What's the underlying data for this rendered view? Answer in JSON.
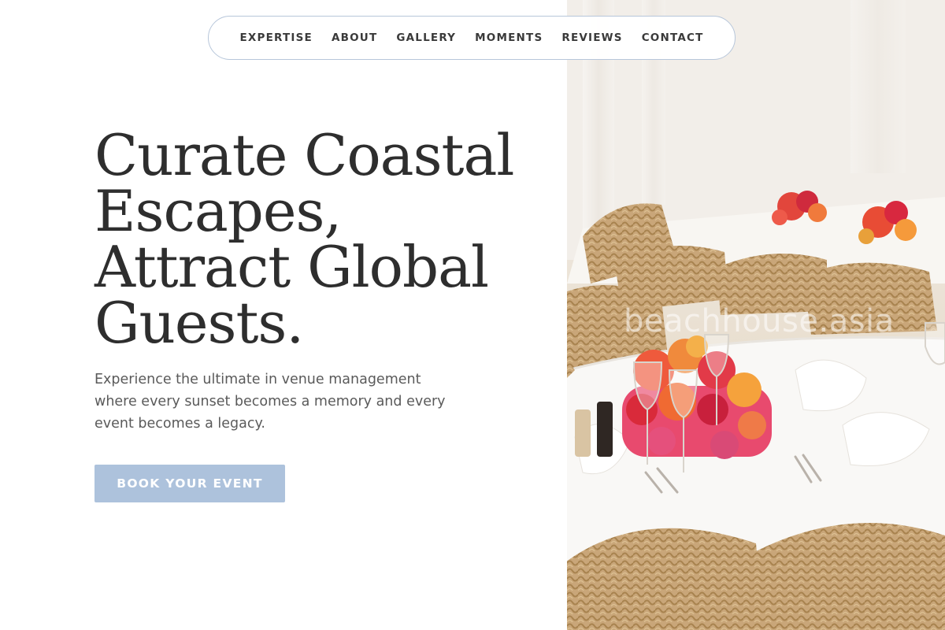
{
  "nav": {
    "items": [
      "EXPERTISE",
      "ABOUT",
      "GALLERY",
      "MOMENTS",
      "REVIEWS",
      "CONTACT"
    ]
  },
  "hero": {
    "headline_lines": [
      "Curate Coastal",
      "Escapes,",
      "Attract Global",
      "Guests."
    ],
    "subtitle": "Experience the ultimate in venue management where every sunset becomes a memory and every event becomes a legacy.",
    "cta_label": "BOOK YOUR EVENT"
  },
  "photo": {
    "subject": "event-table-setting",
    "watermark": "beachhouse.asia"
  },
  "colors": {
    "accent": "#adc2dc",
    "nav_border": "#b7c6da",
    "headline": "#2e2e2e",
    "body_text": "#5a5a5a"
  }
}
